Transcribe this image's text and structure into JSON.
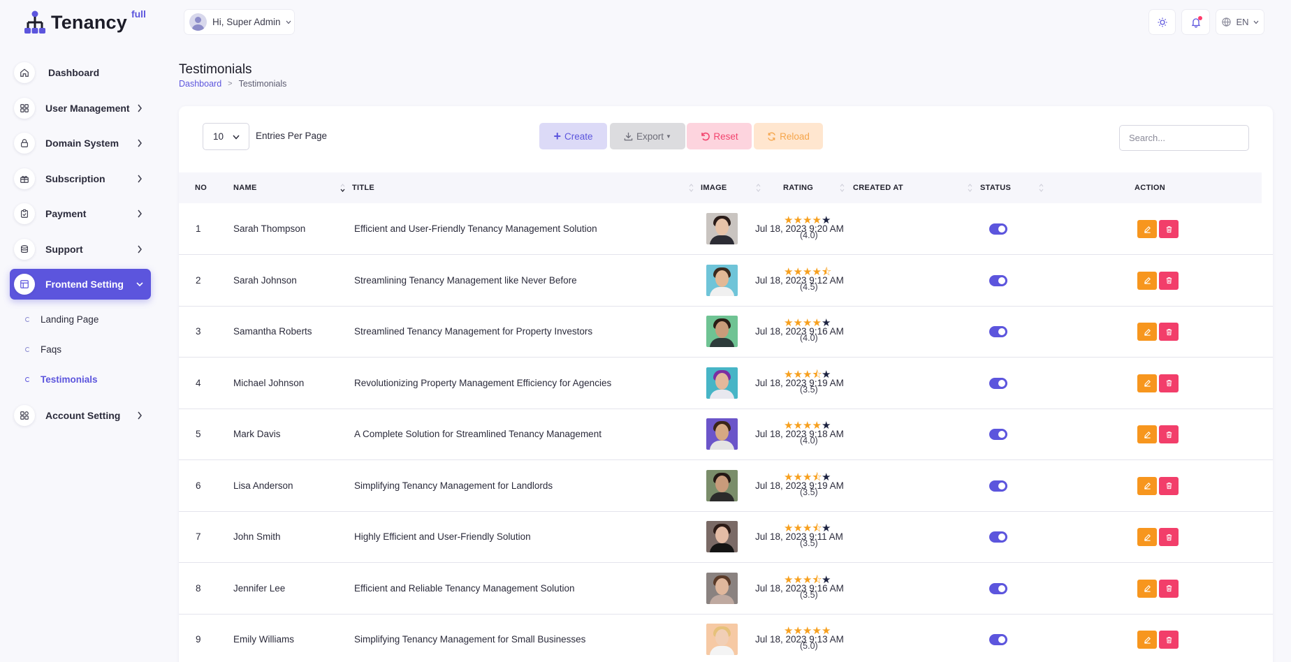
{
  "brand": {
    "name": "Tenancy",
    "badge": "full"
  },
  "colors": {
    "primary": "#5c55dd",
    "edit": "#f7961e",
    "delete": "#f23e6a",
    "star": "#f7a01e",
    "star_empty": "#1c2240"
  },
  "sidebar": {
    "items": [
      {
        "label": "Dashboard",
        "icon": "home-icon"
      },
      {
        "label": "User Management",
        "icon": "grid-icon"
      },
      {
        "label": "Domain System",
        "icon": "lock-icon"
      },
      {
        "label": "Subscription",
        "icon": "gift-icon"
      },
      {
        "label": "Payment",
        "icon": "clipboard-icon"
      },
      {
        "label": "Support",
        "icon": "database-icon"
      },
      {
        "label": "Frontend Setting",
        "icon": "layout-icon"
      },
      {
        "label": "Account Setting",
        "icon": "apps-icon"
      }
    ],
    "sub_items": [
      {
        "label": "Landing Page"
      },
      {
        "label": "Faqs"
      },
      {
        "label": "Testimonials"
      }
    ]
  },
  "header": {
    "greeting": "Hi, Super Admin",
    "language": "EN"
  },
  "page": {
    "title": "Testimonials",
    "breadcrumb": {
      "home": "Dashboard",
      "current": "Testimonials"
    }
  },
  "toolbar": {
    "entries_value": "10",
    "entries_label": "Entries Per Page",
    "create": "Create",
    "export": "Export",
    "reset": "Reset",
    "reload": "Reload",
    "search_placeholder": "Search..."
  },
  "table": {
    "columns": [
      "NO",
      "NAME",
      "TITLE",
      "IMAGE",
      "RATING",
      "CREATED AT",
      "STATUS",
      "ACTION"
    ],
    "rows": [
      {
        "no": "1",
        "name": "Sarah Thompson",
        "title": "Efficient and User-Friendly Tenancy Management Solution",
        "rating": 4.0,
        "rating_text": "(4.0)",
        "created": "Jul 18, 2023 9:20 AM",
        "status": true
      },
      {
        "no": "2",
        "name": "Sarah Johnson",
        "title": "Streamlining Tenancy Management like Never Before",
        "rating": 4.5,
        "rating_text": "(4.5)",
        "created": "Jul 18, 2023 9:12 AM",
        "status": true
      },
      {
        "no": "3",
        "name": "Samantha Roberts",
        "title": "Streamlined Tenancy Management for Property Investors",
        "rating": 4.0,
        "rating_text": "(4.0)",
        "created": "Jul 18, 2023 9:16 AM",
        "status": true
      },
      {
        "no": "4",
        "name": "Michael Johnson",
        "title": "Revolutionizing Property Management Efficiency for Agencies",
        "rating": 3.5,
        "rating_text": "(3.5)",
        "created": "Jul 18, 2023 9:19 AM",
        "status": true
      },
      {
        "no": "5",
        "name": "Mark Davis",
        "title": "A Complete Solution for Streamlined Tenancy Management",
        "rating": 4.0,
        "rating_text": "(4.0)",
        "created": "Jul 18, 2023 9:18 AM",
        "status": true
      },
      {
        "no": "6",
        "name": "Lisa Anderson",
        "title": "Simplifying Tenancy Management for Landlords",
        "rating": 3.5,
        "rating_text": "(3.5)",
        "created": "Jul 18, 2023 9:19 AM",
        "status": true
      },
      {
        "no": "7",
        "name": "John Smith",
        "title": "Highly Efficient and User-Friendly Solution",
        "rating": 3.5,
        "rating_text": "(3.5)",
        "created": "Jul 18, 2023 9:11 AM",
        "status": true
      },
      {
        "no": "8",
        "name": "Jennifer Lee",
        "title": "Efficient and Reliable Tenancy Management Solution",
        "rating": 3.5,
        "rating_text": "(3.5)",
        "created": "Jul 18, 2023 9:16 AM",
        "status": true
      },
      {
        "no": "9",
        "name": "Emily Williams",
        "title": "Simplifying Tenancy Management for Small Businesses",
        "rating": 5.0,
        "rating_text": "(5.0)",
        "created": "Jul 18, 2023 9:13 AM",
        "status": true
      }
    ]
  }
}
